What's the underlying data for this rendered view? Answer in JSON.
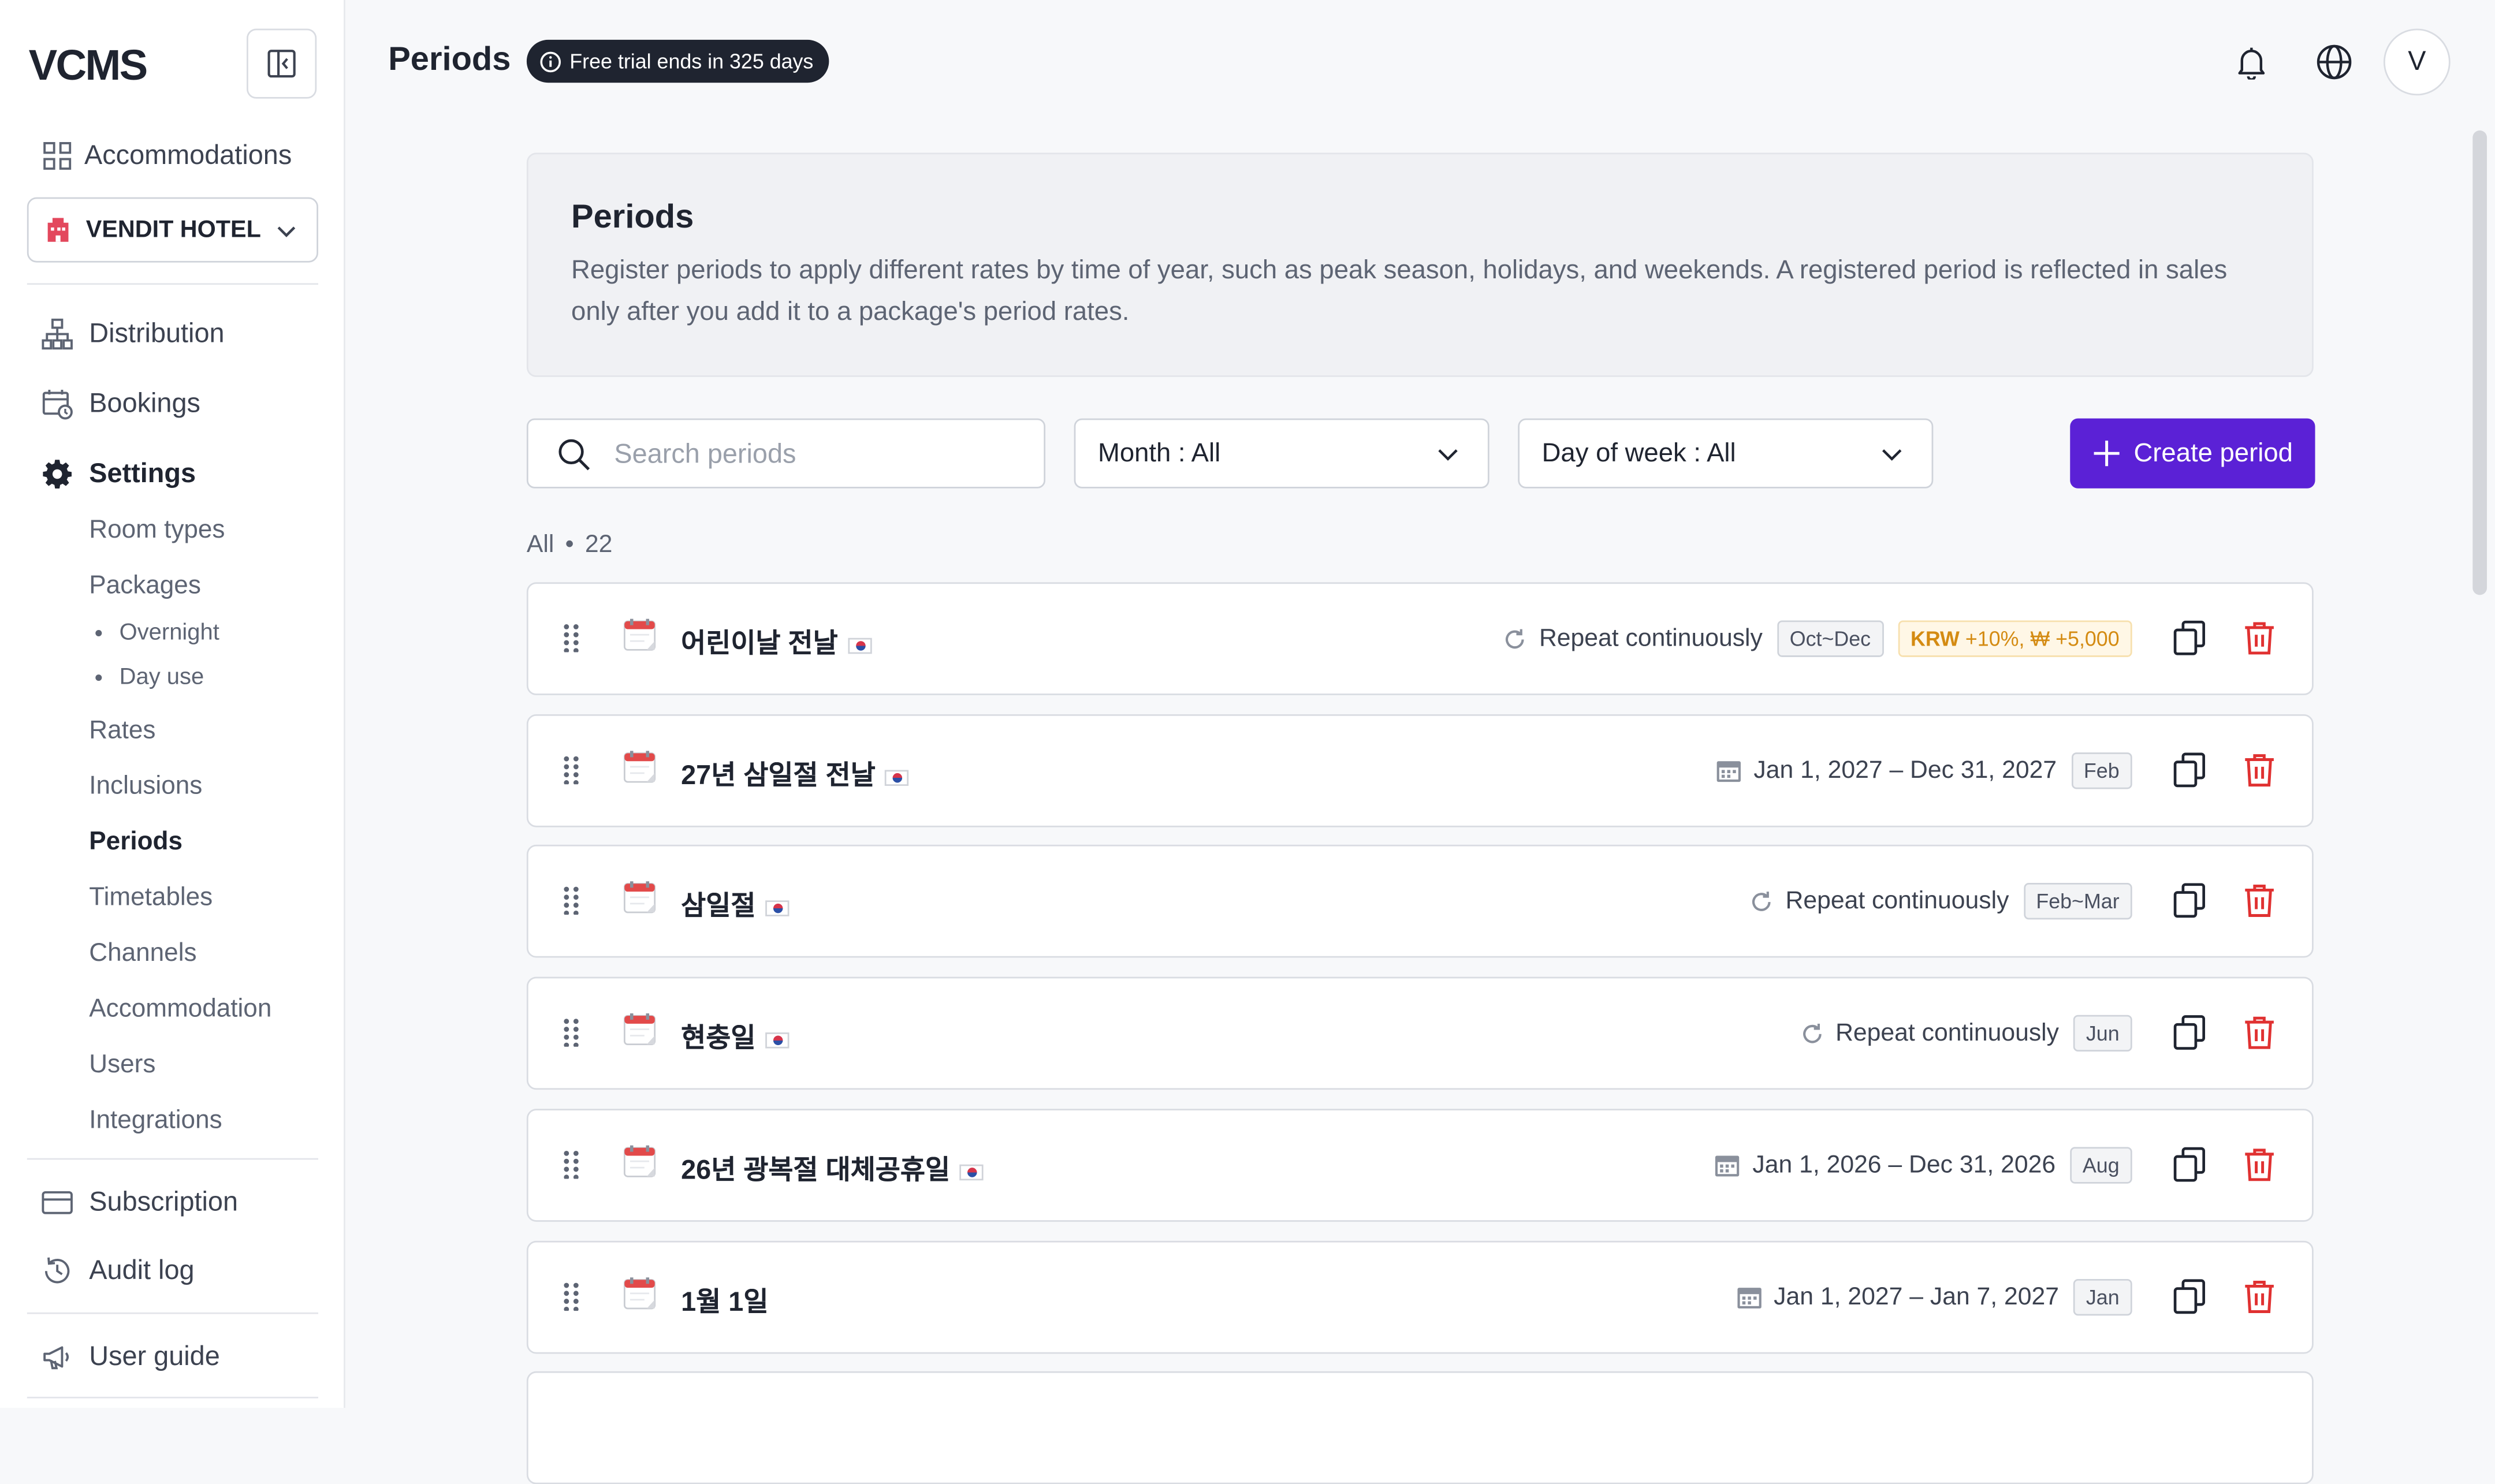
{
  "app": {
    "logo": "VCMS"
  },
  "sidebar": {
    "accommodations": "Accommodations",
    "hotel": "VENDIT HOTEL",
    "distribution": "Distribution",
    "bookings": "Bookings",
    "settings": "Settings",
    "settings_items": {
      "room_types": "Room types",
      "packages": "Packages",
      "overnight": "Overnight",
      "day_use": "Day use",
      "rates": "Rates",
      "inclusions": "Inclusions",
      "periods": "Periods",
      "timetables": "Timetables",
      "channels": "Channels",
      "accommodation": "Accommodation",
      "users": "Users",
      "integrations": "Integrations"
    },
    "subscription": "Subscription",
    "audit_log": "Audit log",
    "user_guide": "User guide"
  },
  "header": {
    "title": "Periods",
    "trial_badge": "Free trial ends in 325 days",
    "avatar_initial": "V"
  },
  "info": {
    "title": "Periods",
    "description": "Register periods to apply different rates by time of year, such as peak season, holidays, and weekends. A registered period is reflected in sales only after you add it to a package's period rates."
  },
  "controls": {
    "search_placeholder": "Search periods",
    "month_filter": "Month : All",
    "dow_filter": "Day of week : All",
    "create_button": "Create period"
  },
  "list": {
    "filter_label": "All",
    "count": "22",
    "rows": [
      {
        "name": "어린이날 전날",
        "flag": true,
        "meta": "Repeat continuously",
        "meta_type": "repeat",
        "tag": "Oct~Dec",
        "krw_prefix": "KRW",
        "krw_rest": "+10%, ₩ +5,000"
      },
      {
        "name": "27년 삼일절 전날",
        "flag": true,
        "meta": "Jan 1, 2027 – Dec 31, 2027",
        "meta_type": "date",
        "tag": "Feb"
      },
      {
        "name": "삼일절",
        "flag": true,
        "meta": "Repeat continuously",
        "meta_type": "repeat",
        "tag": "Feb~Mar"
      },
      {
        "name": "현충일",
        "flag": true,
        "meta": "Repeat continuously",
        "meta_type": "repeat",
        "tag": "Jun"
      },
      {
        "name": "26년 광복절 대체공휴일",
        "flag": true,
        "meta": "Jan 1, 2026 – Dec 31, 2026",
        "meta_type": "date",
        "tag": "Aug"
      },
      {
        "name": "1월 1일",
        "flag": false,
        "meta": "Jan 1, 2027 – Jan 7, 2027",
        "meta_type": "date",
        "tag": "Jan"
      }
    ]
  },
  "colors": {
    "primary": "#5b21d6",
    "danger": "#e03131",
    "krw_text": "#d48b12",
    "badge_bg": "#1f2430"
  }
}
